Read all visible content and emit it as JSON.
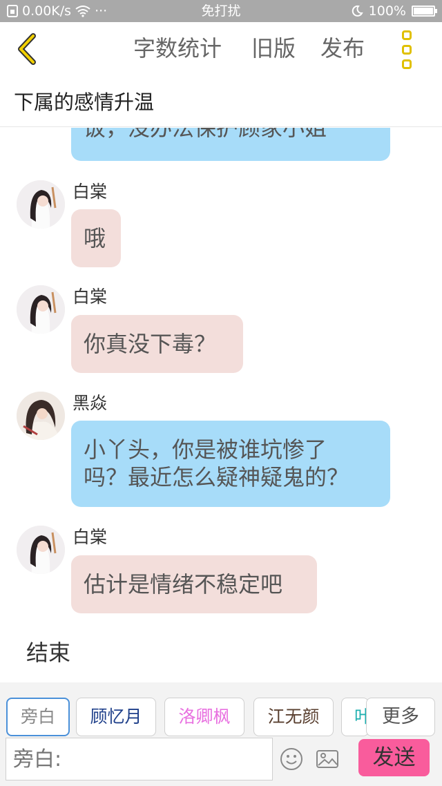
{
  "status_bar": {
    "speed": "0.00K/s",
    "dots": "···",
    "mode": "免打扰",
    "battery": "100%",
    "battery_level": 1.0
  },
  "toolbar": {
    "word_count": "字数统计",
    "old_version": "旧版",
    "publish": "发布"
  },
  "chapter_title": "下属的感情升温",
  "messages": [
    {
      "speaker": "",
      "text": "饭，没办法保护顾家小姐",
      "style": "blue"
    },
    {
      "speaker": "白棠",
      "text": "哦",
      "style": "pink"
    },
    {
      "speaker": "白棠",
      "text": "你真没下毒？",
      "style": "pink"
    },
    {
      "speaker": "黑焱",
      "text_line1": "小丫头，你是被谁坑惨了",
      "text_line2": "吗？最近怎么疑神疑鬼的？",
      "style": "blue"
    },
    {
      "speaker": "白棠",
      "text": "估计是情绪不稳定吧",
      "style": "pink"
    }
  ],
  "end_text": "结束",
  "roles": [
    {
      "label": "旁白",
      "color": "#888888"
    },
    {
      "label": "顾忆月",
      "color": "#1e3f8a"
    },
    {
      "label": "洛卿枫",
      "color": "#e870e0"
    },
    {
      "label": "江无颜",
      "color": "#5a4030"
    },
    {
      "label": "叶",
      "color": "#20b0b0"
    }
  ],
  "more_roles": "更多",
  "input": {
    "placeholder": "旁白:"
  },
  "send_label": "发送",
  "colors": {
    "accent_yellow": "#e0c000",
    "bubble_blue": "#a7dcf9",
    "bubble_pink": "#f3dedb",
    "send_pink": "#f95c9c"
  }
}
